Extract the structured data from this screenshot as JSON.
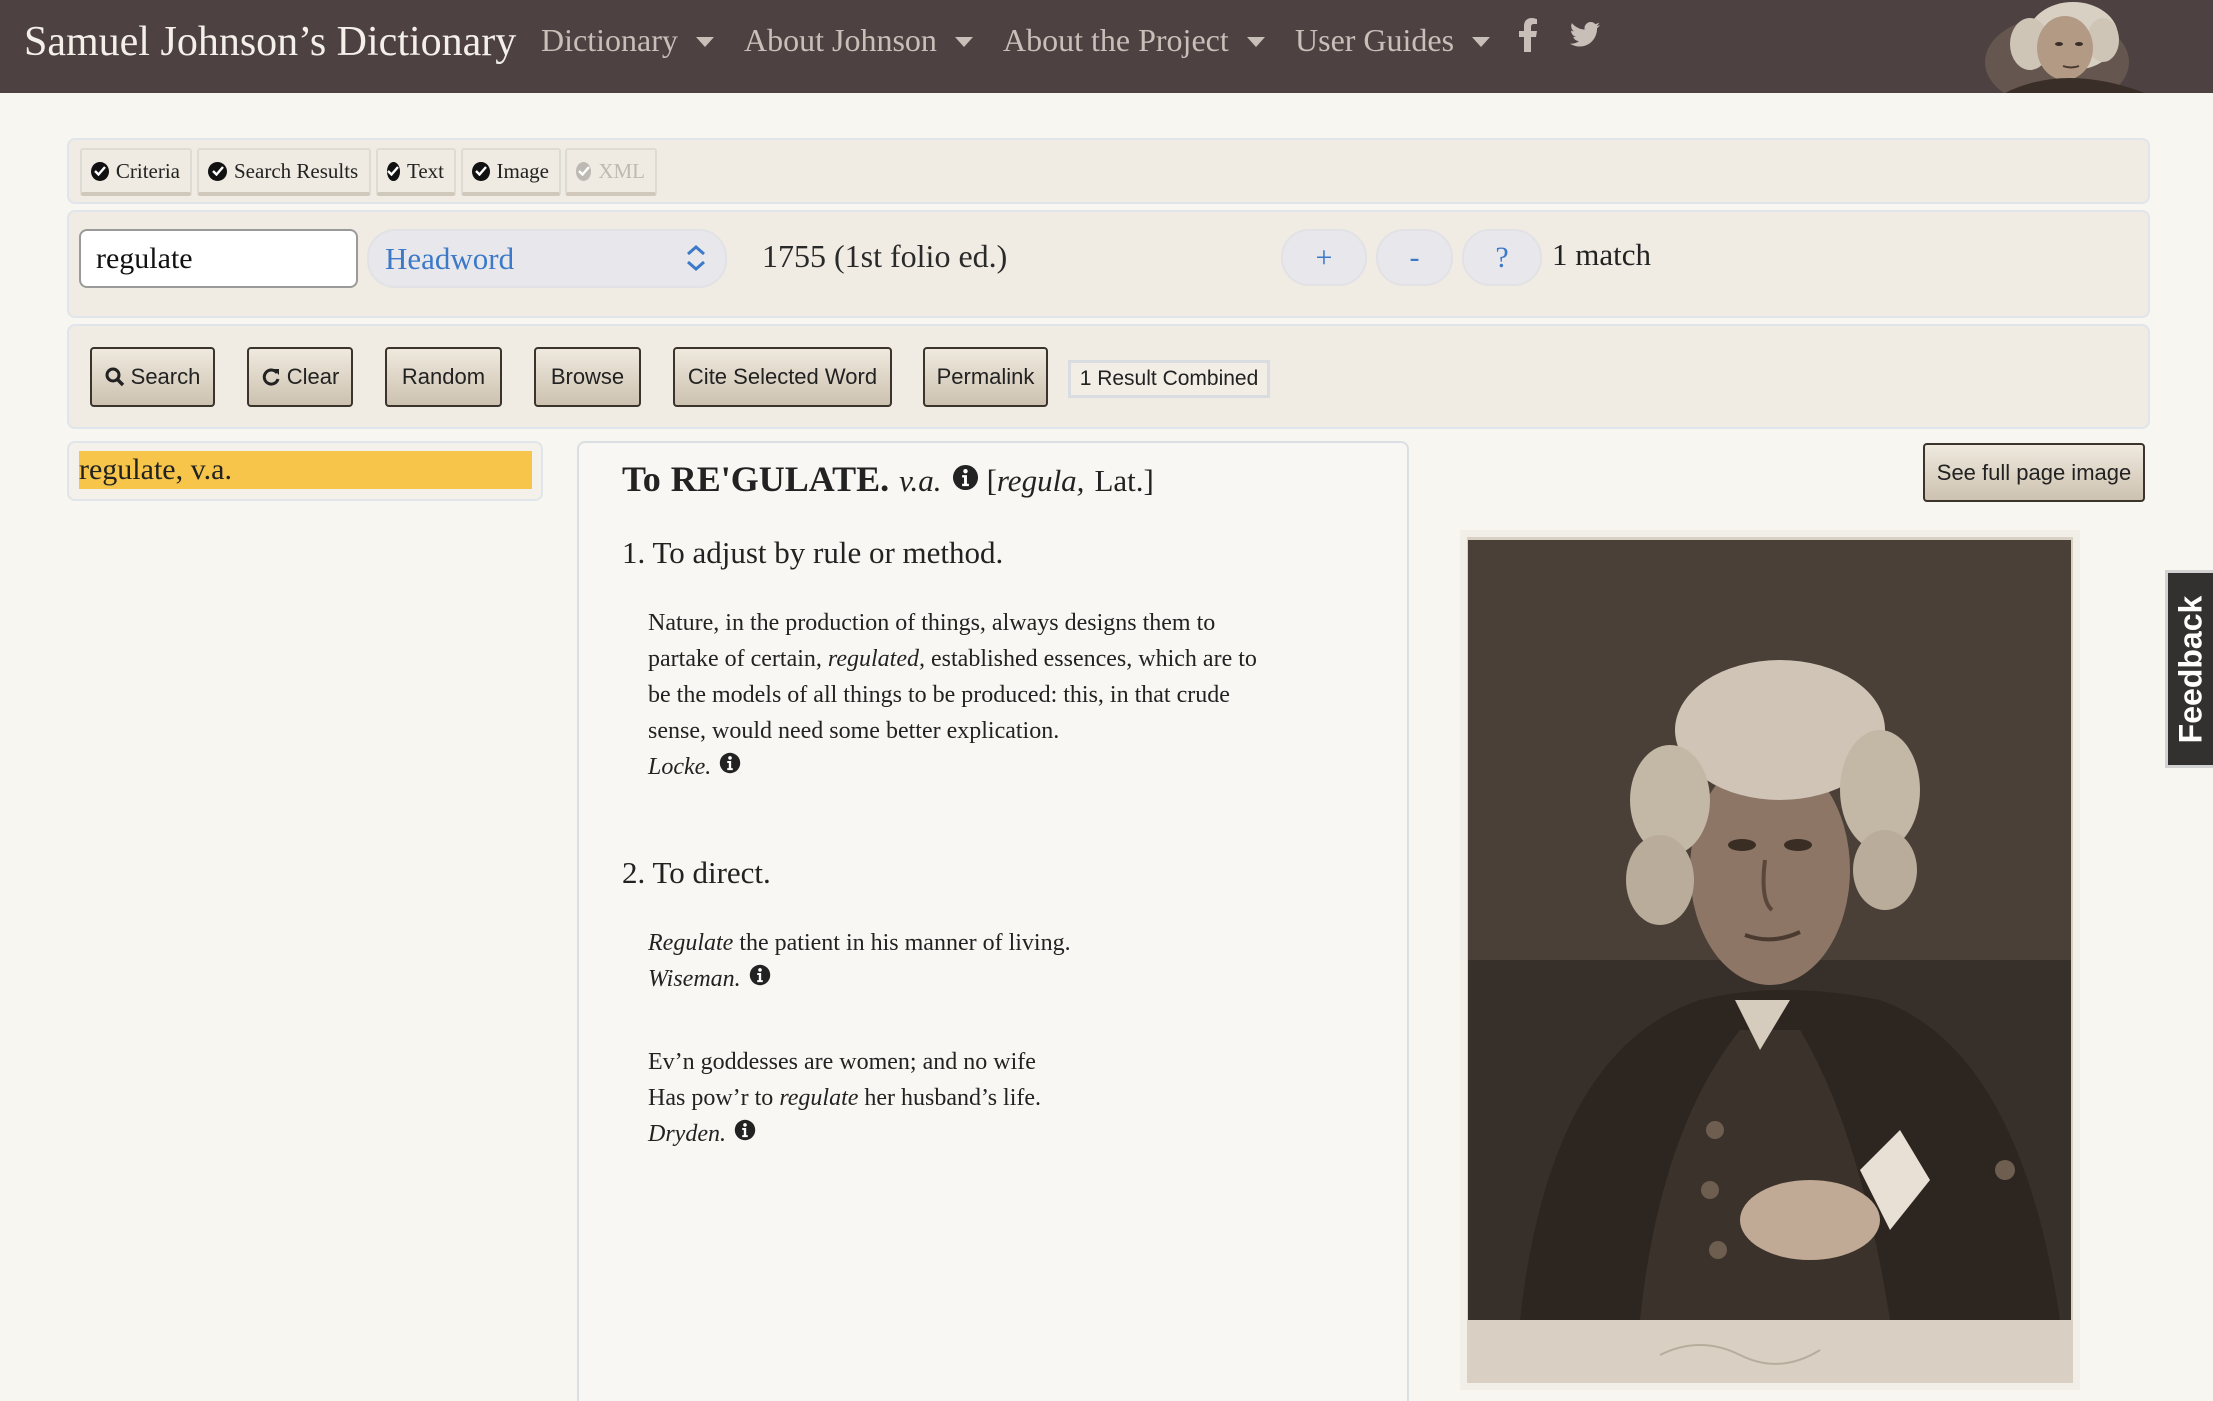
{
  "navbar": {
    "brand": "Samuel Johnson’s Dictionary",
    "menus": [
      {
        "label": "Dictionary"
      },
      {
        "label": "About Johnson"
      },
      {
        "label": "About the Project"
      },
      {
        "label": "User Guides"
      }
    ],
    "social": [
      "facebook-icon",
      "twitter-icon"
    ]
  },
  "view_tabs": [
    {
      "label": "Criteria",
      "enabled": true
    },
    {
      "label": "Search Results",
      "enabled": true
    },
    {
      "label": "Text",
      "enabled": true
    },
    {
      "label": "Image",
      "enabled": true
    },
    {
      "label": "XML",
      "enabled": false
    }
  ],
  "query": {
    "search_value": "regulate",
    "field_select": "Headword",
    "edition": "1755 (1st folio ed.)",
    "plus_label": "+",
    "minus_label": "-",
    "help_label": "?",
    "match_count": "1 match"
  },
  "actions": {
    "search": "Search",
    "clear": "Clear",
    "random": "Random",
    "browse": "Browse",
    "cite": "Cite Selected Word",
    "permalink": "Permalink",
    "result_combined": "1 Result Combined"
  },
  "results": [
    {
      "label": "regulate, v.a."
    }
  ],
  "entry": {
    "prefix": "To",
    "headword": "RE'GULATE.",
    "pos": "v.a.",
    "etymology_open": "[",
    "etymology_word": "regula,",
    "etymology_lang": "Lat.]",
    "senses": [
      {
        "number": "1.",
        "definition": "To adjust by rule or method.",
        "quotes": [
          {
            "lines": [
              "Nature, in the production of things, always designs them to",
              "partake of certain, ",
              "regulated,",
              " established essences, which are to",
              "be the models of all things to be produced: this, in that crude",
              "sense, would need some better explication."
            ],
            "author": "Locke."
          }
        ]
      },
      {
        "number": "2.",
        "definition": "To direct.",
        "quotes": [
          {
            "lines": [
              "Regulate",
              " the patient in his manner of living."
            ],
            "author": "Wiseman."
          },
          {
            "lines": [
              "Ev’n goddesses are women; and no wife",
              "Has pow’r to ",
              "regulate",
              " her husband’s life."
            ],
            "author": "Dryden."
          }
        ]
      }
    ]
  },
  "image_panel": {
    "full_page_button": "See full page image"
  },
  "feedback_tab": "Feedback",
  "colors": {
    "navbar_bg": "#4d4241",
    "result_highlight": "#f6c54a",
    "select_text": "#3c79c9"
  }
}
